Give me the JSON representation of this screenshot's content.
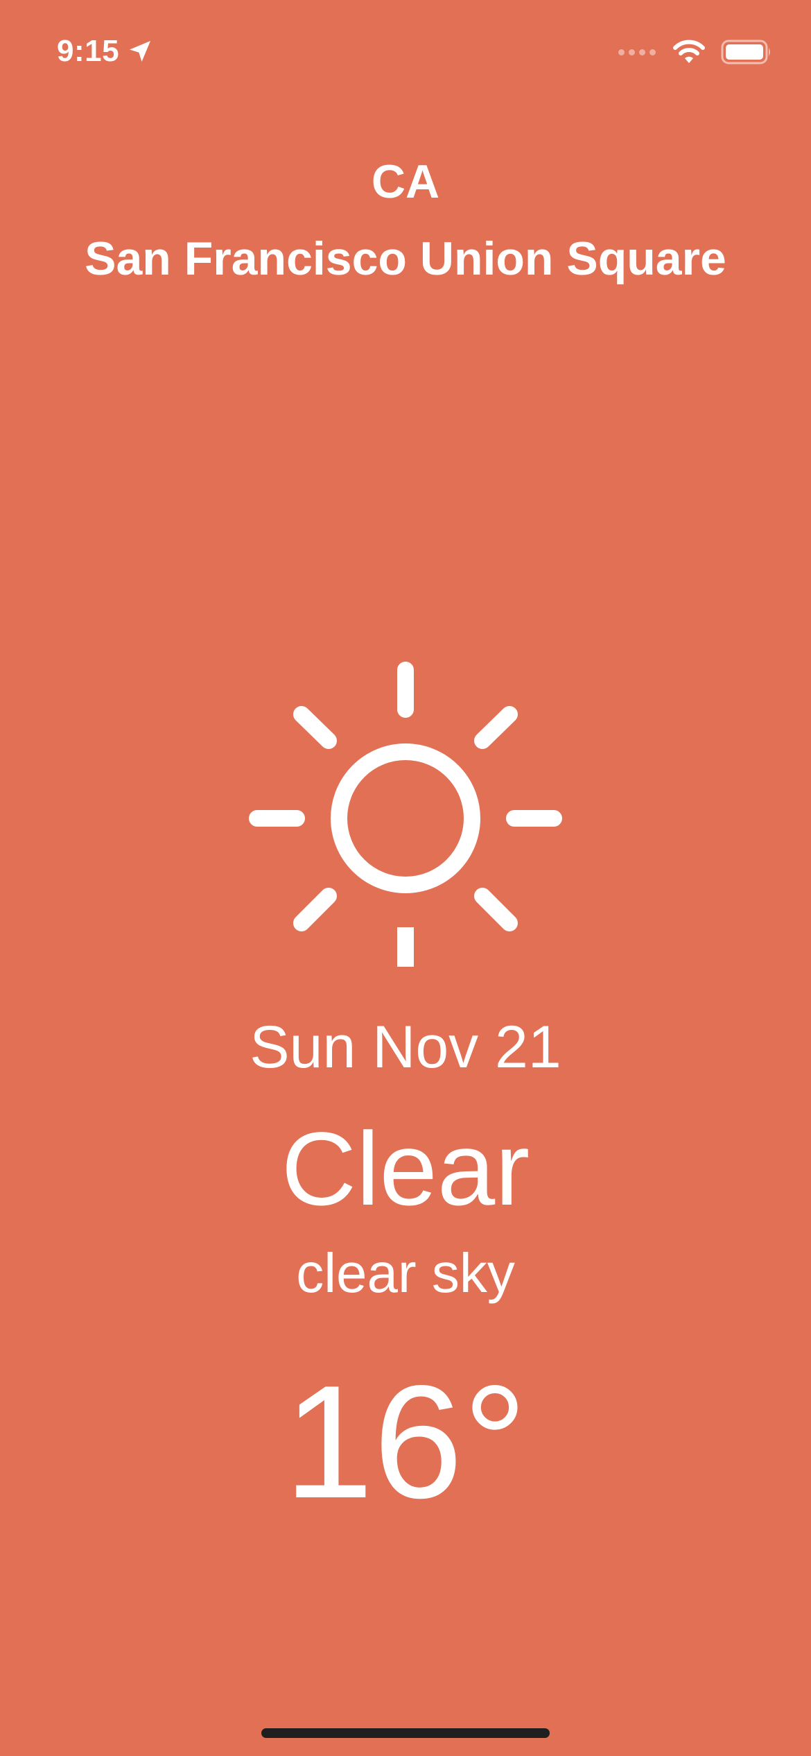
{
  "status_bar": {
    "time": "9:15",
    "icons": [
      "location-arrow-icon",
      "signal-icon",
      "wifi-icon",
      "battery-icon"
    ]
  },
  "header": {
    "region": "CA",
    "city": "San Francisco Union Square"
  },
  "weather": {
    "icon": "sun-icon",
    "date": "Sun Nov 21",
    "condition": "Clear",
    "description": "clear sky",
    "temperature": "16°"
  },
  "colors": {
    "background": "#E27055",
    "foreground": "#FFFFFF",
    "home_indicator": "#1F1F1F"
  }
}
